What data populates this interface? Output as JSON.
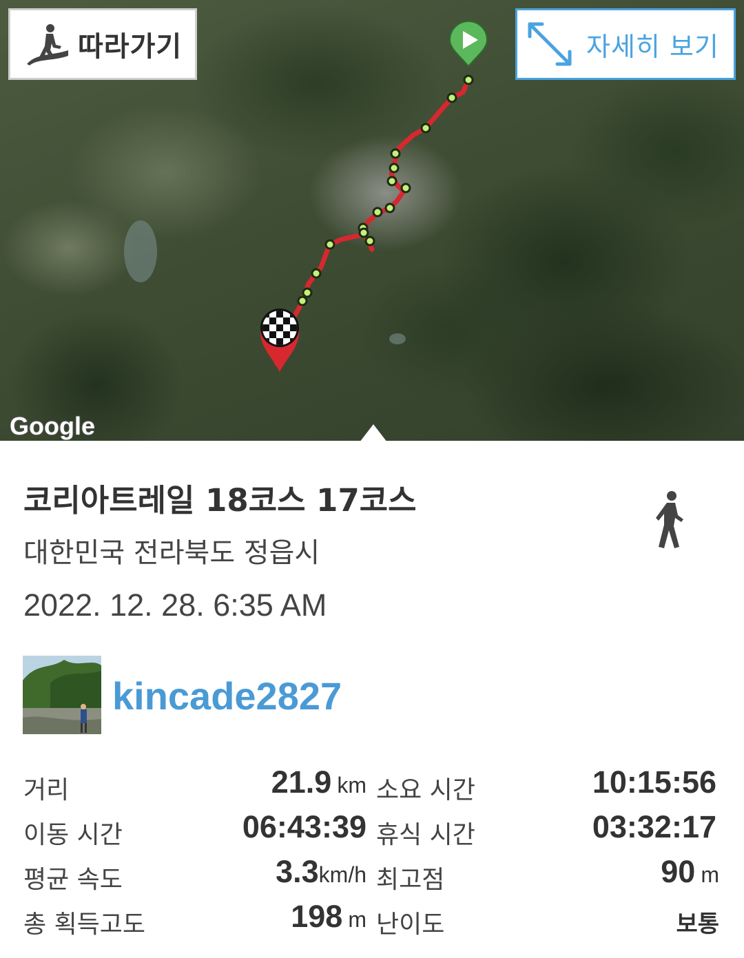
{
  "map": {
    "follow_button_label": "따라가기",
    "detail_button_label": "자세히 보기",
    "attribution": "Google",
    "start_marker_icon": "play-icon",
    "finish_marker_icon": "checkered-flag-icon",
    "route_color": "#d7282f",
    "start_color": "#5cb85c",
    "accent_color": "#4aa3e0"
  },
  "trail": {
    "title": "코리아트레일 18코스 17코스",
    "location": "대한민국 전라북도 정읍시",
    "datetime": "2022. 12. 28. 6:35 AM",
    "activity_icon": "walking-person-icon"
  },
  "user": {
    "name": "kincade2827",
    "name_color": "#4a9ad5"
  },
  "stats": {
    "distance": {
      "label": "거리",
      "value": "21.9",
      "unit": "km"
    },
    "elapsed": {
      "label": "소요 시간",
      "value": "10:15:56",
      "unit": ""
    },
    "moving": {
      "label": "이동 시간",
      "value": "06:43:39",
      "unit": ""
    },
    "rest": {
      "label": "휴식 시간",
      "value": "03:32:17",
      "unit": ""
    },
    "avg_speed": {
      "label": "평균 속도",
      "value": "3.3",
      "unit": "km/h"
    },
    "max_elev": {
      "label": "최고점",
      "value": "90",
      "unit": "m"
    },
    "total_gain": {
      "label": "총 획득고도",
      "value": "198",
      "unit": "m"
    },
    "difficulty": {
      "label": "난이도",
      "value": "보통",
      "unit": ""
    }
  }
}
